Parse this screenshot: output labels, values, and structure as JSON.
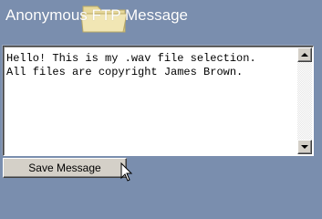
{
  "header": {
    "title": "Anonymous FTP Message",
    "icon": "folder-icon"
  },
  "message": {
    "lines": [
      "Hello! This is my .wav file selection.",
      "All files are copyright James Brown."
    ]
  },
  "actions": {
    "save_label": "Save Message"
  },
  "colors": {
    "background": "#7a8eae",
    "folder": "#e8d99a",
    "button_face": "#d4d0c8"
  }
}
